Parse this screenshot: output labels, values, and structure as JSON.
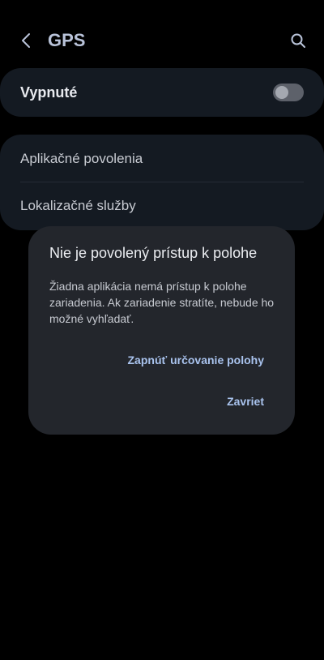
{
  "header": {
    "title": "GPS",
    "back_icon": "chevron-left-icon",
    "search_icon": "search-icon"
  },
  "toggle_card": {
    "label": "Vypnuté",
    "switch_on": false
  },
  "list_card": {
    "items": [
      {
        "label": "Aplikačné povolenia"
      },
      {
        "label": "Lokalizačné služby"
      }
    ]
  },
  "dialog": {
    "title": "Nie je povolený prístup k polohe",
    "body": "Žiadna aplikácia nemá prístup k polohe zariadenia. Ak zariadenie stratíte, nebude ho možné vyhľadať.",
    "enable_label": "Zapnúť určovanie polohy",
    "close_label": "Zavriet"
  },
  "colors": {
    "background": "#000000",
    "card": "#141a22",
    "dialog": "#23262c",
    "accent": "#a9c3ee",
    "title": "#b9c3d9"
  }
}
